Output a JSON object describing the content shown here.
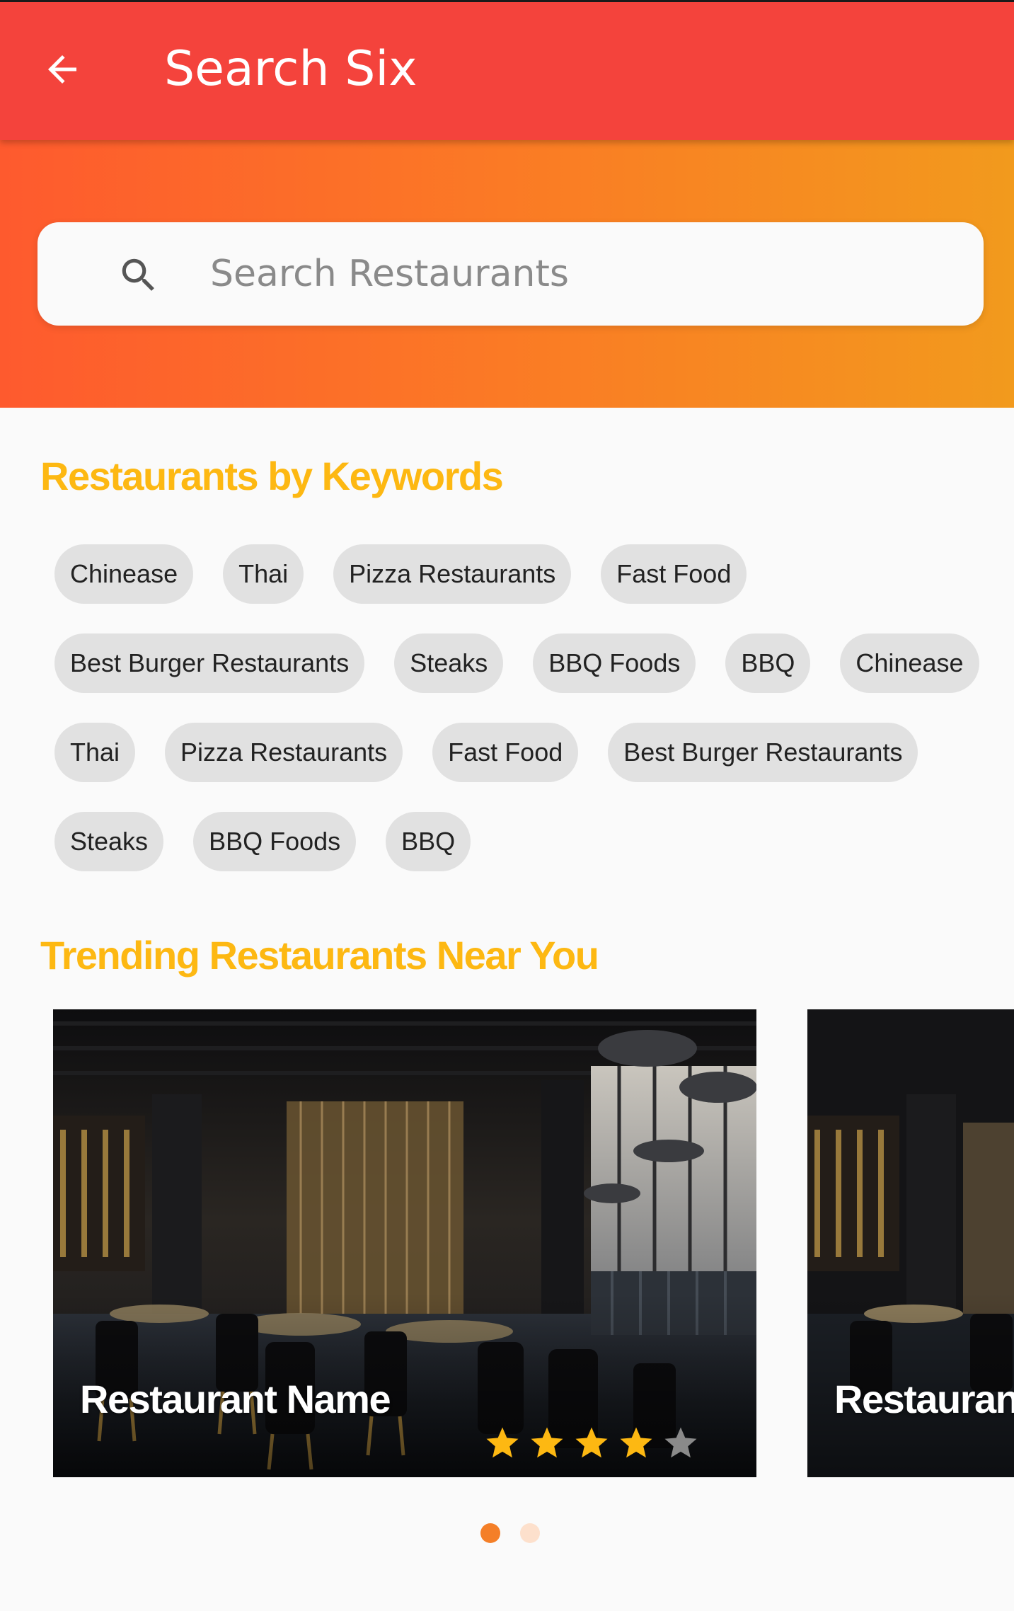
{
  "app_bar": {
    "title": "Search Six",
    "back_icon": "arrow-left-icon",
    "background": "#f4433c"
  },
  "search": {
    "placeholder": "Search Restaurants",
    "value": "",
    "icon": "search-icon"
  },
  "keywords_section": {
    "title": "Restaurants by Keywords",
    "rows": [
      [
        "Chinease",
        "Thai",
        "Pizza Restaurants",
        "Fast Food"
      ],
      [
        "Best Burger Restaurants",
        "Steaks",
        "BBQ Foods",
        "BBQ",
        "Chinease"
      ],
      [
        "Thai",
        "Pizza Restaurants",
        "Fast Food",
        "Best Burger Restaurants"
      ],
      [
        "Steaks",
        "BBQ Foods",
        "BBQ"
      ]
    ]
  },
  "trending_section": {
    "title": "Trending Restaurants Near You",
    "cards": [
      {
        "name": "Restaurant Name",
        "rating": 4,
        "max_rating": 5
      },
      {
        "name": "Restaurant Name"
      }
    ],
    "pager": {
      "count": 2,
      "active": 0
    }
  },
  "colors": {
    "accent_orange": "#f47f28",
    "section_title": "#fdb812",
    "star_filled": "#fdb812",
    "star_empty": "#8a8a8a",
    "gradient": [
      "#fe5a2e",
      "#f29a1d"
    ]
  }
}
